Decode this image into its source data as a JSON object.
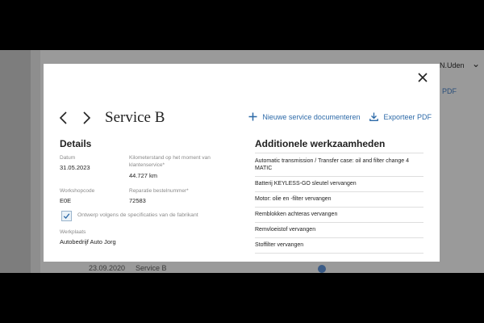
{
  "background": {
    "user_name": "N.Uden",
    "link_text": "PDF",
    "row": {
      "date": "23.09.2020",
      "service": "Service B"
    }
  },
  "modal": {
    "title": "Service B",
    "actions": {
      "new_service": "Nieuwe service documenteren",
      "export_pdf": "Exporteer PDF"
    },
    "details": {
      "heading": "Details",
      "date_label": "Datum",
      "date_value": "31.05.2023",
      "km_label": "Kilometerstand op het moment van klantenservice*",
      "km_value": "44.727 km",
      "workshop_code_label": "Workshopcode",
      "workshop_code_value": "E0E",
      "repair_order_label": "Reparatie bestelnummer*",
      "repair_order_value": "72583",
      "spec_checkbox_label": "Ontwerp volgens de specificaties van de fabrikant",
      "spec_checked": true,
      "workshop_label": "Werkplaats",
      "workshop_value": "Autobedrijf Auto Jorg"
    },
    "additional": {
      "heading": "Additionele werkzaamheden",
      "items": [
        "Automatic transmission / Transfer case: oil and filter change 4 MATIC",
        "Batterij KEYLESS-GO sleutel vervangen",
        "Motor: olie en -filter vervangen",
        "Remblokken achteras vervangen",
        "Remvloeistof vervangen",
        "Stoffilter vervangen"
      ]
    }
  },
  "colors": {
    "accent": "#2d6aa8",
    "overlay": "#7d7d7d",
    "band": "#000000"
  },
  "icons": [
    "close-icon",
    "chevron-left-icon",
    "chevron-right-icon",
    "plus-icon",
    "download-icon",
    "checkmark-icon"
  ]
}
